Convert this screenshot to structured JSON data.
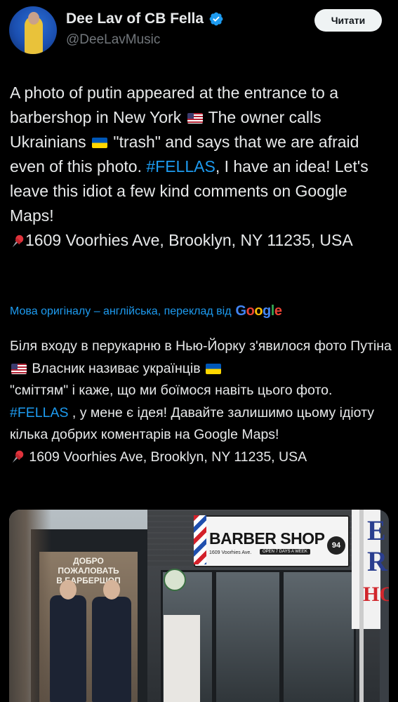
{
  "author": {
    "display_name": "Dee Lav of CB Fella",
    "handle": "@DeeLavMusic",
    "verified": true,
    "follow_label": "Читати"
  },
  "tweet": {
    "segments": [
      {
        "type": "text",
        "value": "A photo of putin appeared at the entrance to a barbershop in New York "
      },
      {
        "type": "flag",
        "value": "us-flag"
      },
      {
        "type": "text",
        "value": " The owner calls Ukrainians "
      },
      {
        "type": "flag",
        "value": "ua-flag"
      },
      {
        "type": "text",
        "value": " \"trash\" and says that we are afraid even of this photo. "
      },
      {
        "type": "hashtag",
        "value": "#FELLAS"
      },
      {
        "type": "text",
        "value": ", I have an idea! Let's leave this idiot a few kind comments on Google Maps!\n"
      },
      {
        "type": "pin",
        "value": "pushpin-icon"
      },
      {
        "type": "text",
        "value": "1609 Voorhies Ave, Brooklyn, NY 11235, USA"
      }
    ]
  },
  "translation": {
    "note": "Мова оригіналу – англійська, переклад від",
    "provider": "Google",
    "segments": [
      {
        "type": "text",
        "value": "Біля входу в перукарню в Нью-Йорку з'явилося фото Путіна "
      },
      {
        "type": "flag",
        "value": "us-flag"
      },
      {
        "type": "text",
        "value": " Власник називає українців "
      },
      {
        "type": "flag",
        "value": "ua-flag"
      },
      {
        "type": "text",
        "value": "\n\"сміттям\" і каже, що ми боїмося навіть цього фото. "
      },
      {
        "type": "hashtag",
        "value": "#FELLAS"
      },
      {
        "type": "text",
        "value": " , у мене є ідея! Давайте залишимо цьому ідіоту кілька добрих коментарів на Google Maps!\n"
      },
      {
        "type": "pin",
        "value": "pushpin-icon"
      },
      {
        "type": "text",
        "value": " 1609 Voorhies Ave, Brooklyn, NY 11235, USA"
      }
    ]
  },
  "media": {
    "poster_text": "ДОБРО ПОЖАЛОВАТЬ\nВ БАРБЕРШОП",
    "sign_title": "BARBER SHOP",
    "sign_address": "1609 Voorhies Ave.",
    "sign_hours": "OPEN 7 DAYS A WEEK",
    "sign_logo": "94",
    "side_sign_letters": [
      "E",
      "R",
      "HO"
    ]
  },
  "colors": {
    "background": "#000000",
    "text": "#e7e9ea",
    "secondary": "#71767b",
    "link": "#1d9bf0",
    "verified": "#1d9bf0"
  }
}
